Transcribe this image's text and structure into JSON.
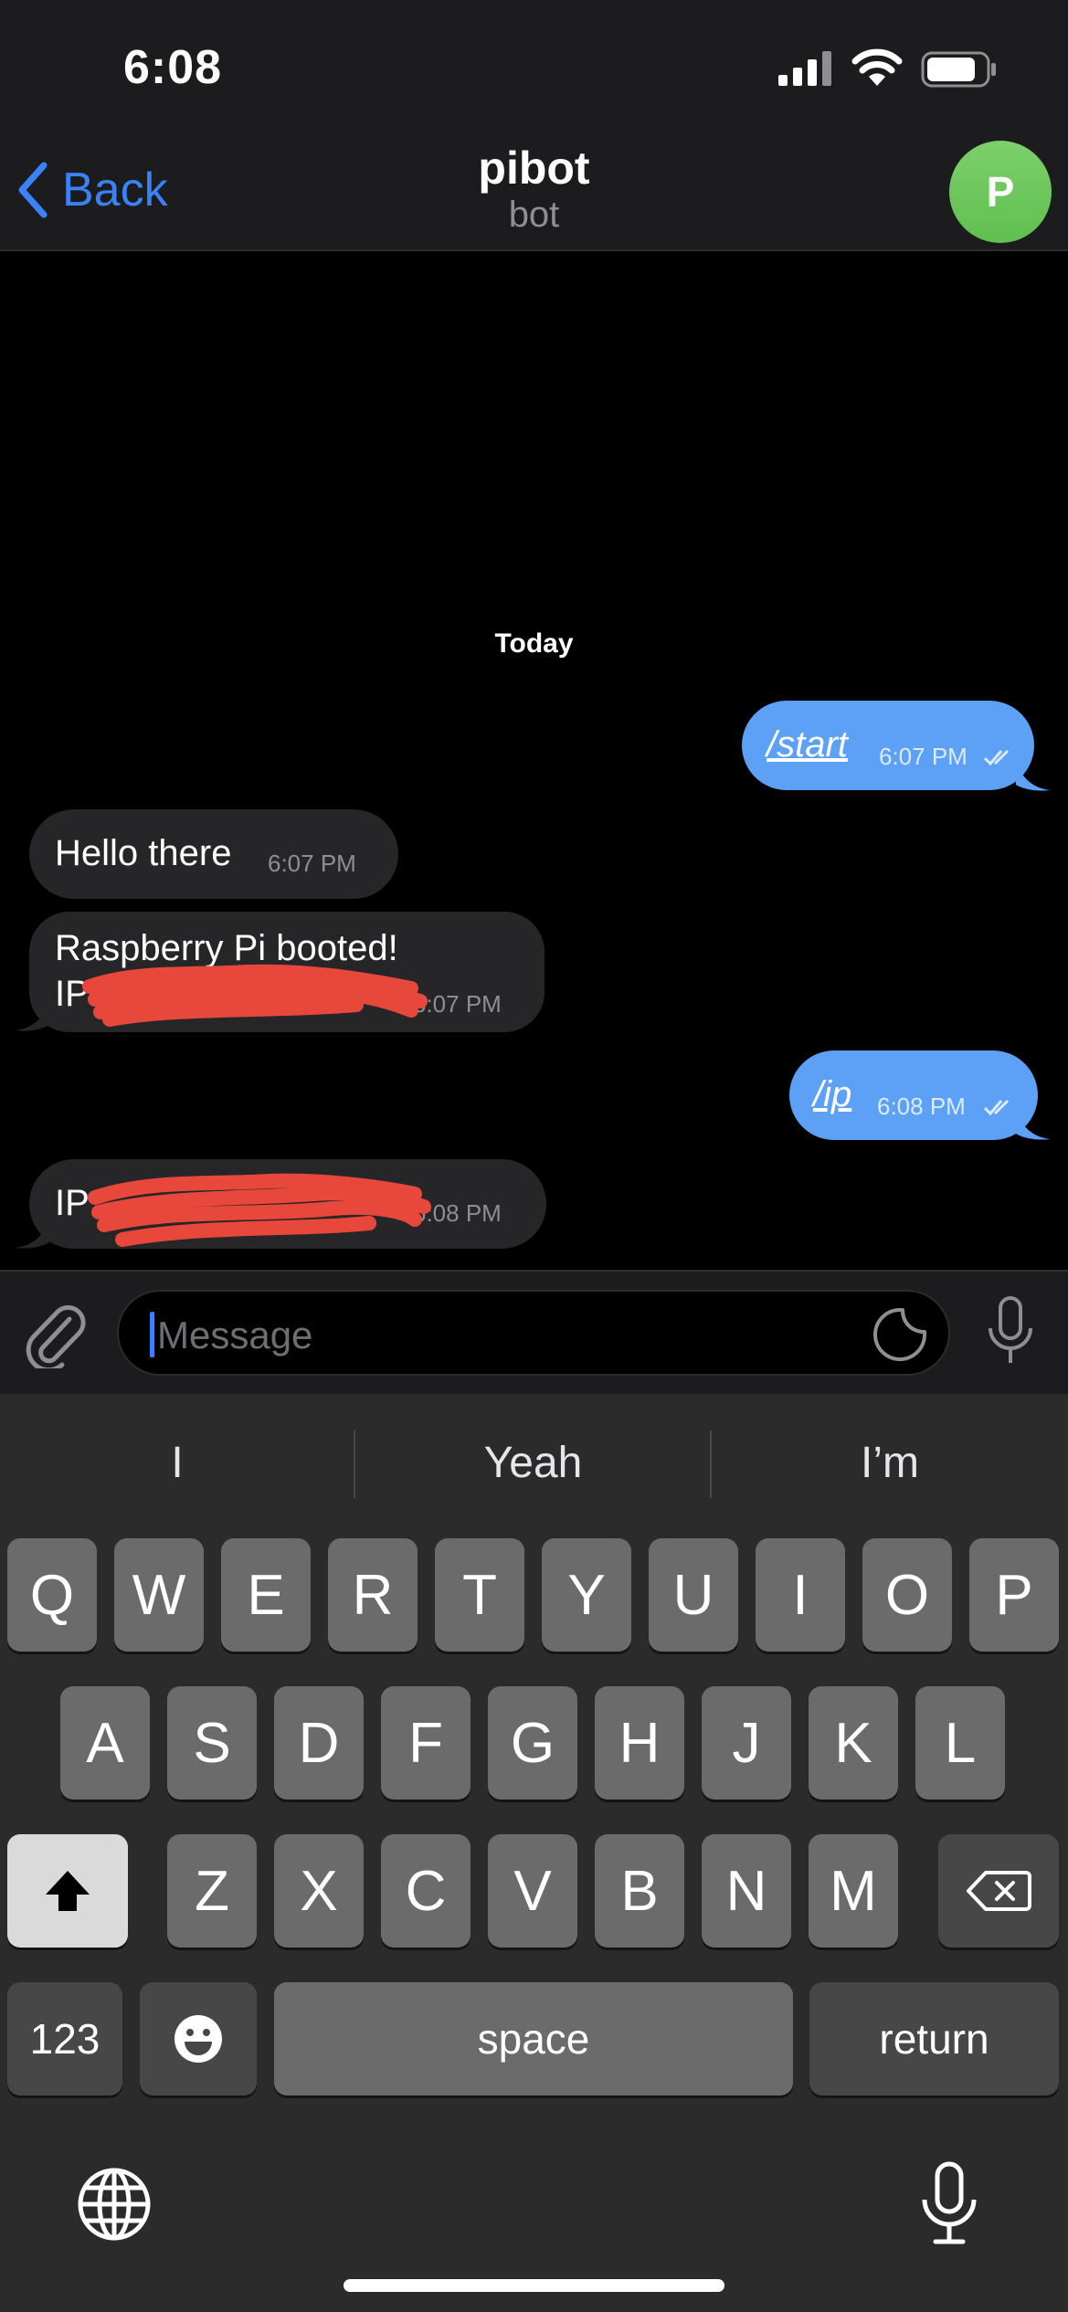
{
  "status_bar": {
    "time": "6:08"
  },
  "nav": {
    "back_label": "Back",
    "title": "pibot",
    "subtitle": "bot",
    "avatar_initial": "P"
  },
  "chat": {
    "date_label": "Today",
    "messages": [
      {
        "direction": "out",
        "text": "/start",
        "time": "6:07 PM",
        "is_command": true
      },
      {
        "direction": "in",
        "text": "Hello there",
        "time": "6:07 PM"
      },
      {
        "direction": "in",
        "text_line1": "Raspberry Pi booted!",
        "text_line2": "IP:",
        "time": "6:07 PM",
        "redacted": true
      },
      {
        "direction": "out",
        "text": "/ip",
        "time": "6:08 PM",
        "is_command": true
      },
      {
        "direction": "in",
        "text": "IP:",
        "time": "6:08 PM",
        "redacted": true
      }
    ]
  },
  "input": {
    "placeholder": "Message"
  },
  "keyboard": {
    "suggestions": [
      "I",
      "Yeah",
      "I’m"
    ],
    "row1": [
      "Q",
      "W",
      "E",
      "R",
      "T",
      "Y",
      "U",
      "I",
      "O",
      "P"
    ],
    "row2": [
      "A",
      "S",
      "D",
      "F",
      "G",
      "H",
      "J",
      "K",
      "L"
    ],
    "row3": [
      "Z",
      "X",
      "C",
      "V",
      "B",
      "N",
      "M"
    ],
    "numbers_label": "123",
    "space_label": "space",
    "return_label": "return"
  },
  "colors": {
    "accent": "#3a82f7",
    "outgoing_bubble": "#5ca1f5",
    "incoming_bubble": "#262628",
    "avatar": "#6cc75c",
    "redaction": "#e8483b"
  }
}
